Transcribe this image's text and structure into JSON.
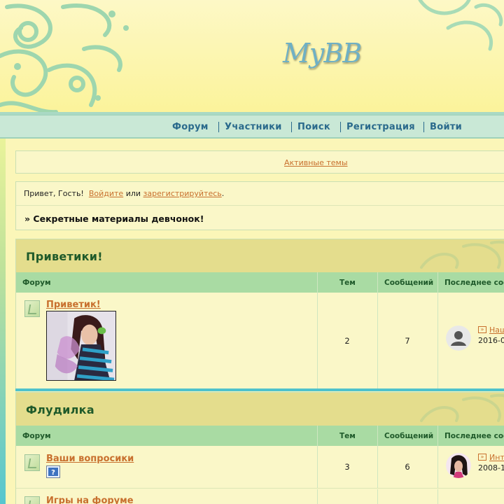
{
  "header": {
    "logo_text": "MyBB"
  },
  "nav": {
    "items": [
      {
        "label": "Форум"
      },
      {
        "label": "Участники"
      },
      {
        "label": "Поиск"
      },
      {
        "label": "Регистрация"
      },
      {
        "label": "Войти"
      }
    ]
  },
  "active_topics": {
    "label": "Активные темы"
  },
  "welcome": {
    "greeting": "Привет, Гость!",
    "login_link": "Войдите",
    "or": "или",
    "register_link": "зарегистрируйтесь",
    "dot": ".",
    "breadcrumb": "» Секретные материалы девчонок!"
  },
  "columns": {
    "forum": "Форум",
    "topics": "Тем",
    "posts": "Сообщений",
    "last": "Последнее соо"
  },
  "categories": [
    {
      "title": "Приветики!",
      "rows": [
        {
          "name": "Приветик!",
          "topics": "2",
          "posts": "7",
          "last_link": "Наш",
          "last_date": "2016-0"
        }
      ]
    },
    {
      "title": "Флудилка",
      "rows": [
        {
          "name": "Ваши вопросики",
          "topics": "3",
          "posts": "6",
          "last_link": "Инт",
          "last_date": "2008-1"
        },
        {
          "name": "Игры на форуме"
        }
      ]
    }
  ],
  "colors": {
    "accent": "#c8702e",
    "heading": "#1f5a2a",
    "nav": "#2a6a8c"
  }
}
